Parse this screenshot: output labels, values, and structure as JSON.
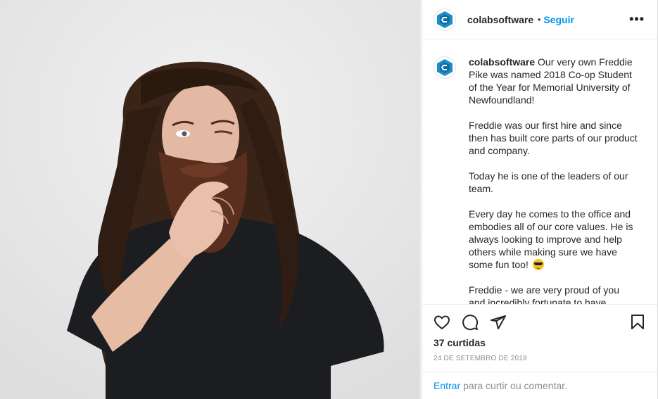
{
  "post": {
    "username": "colabsoftware",
    "follow_separator": "•",
    "follow_label": "Seguir",
    "more_label": "•••",
    "caption": {
      "username": "colabsoftware",
      "first_line": "Our very own Freddie Pike was named 2018 Co-op Student of the Year for Memorial University of Newfoundland!",
      "paragraph_2": "Freddie was our first hire and since then has built core parts of our product and company.",
      "paragraph_3": "Today he is one of the leaders of our team.",
      "paragraph_4": "Every day he comes to the office and embodies all of our core values. He is always looking to improve and help others while making sure we have some fun too!",
      "paragraph_5": "Freddie - we are very proud of you and incredibly fortunate to have"
    },
    "likes_label": "37 curtidas",
    "timestamp": "24 de setembro de 2019",
    "comment_bar": {
      "login_label": "Entrar",
      "rest_text": "para curtir ou comentar."
    }
  },
  "icons": {
    "like": "heart-icon",
    "comment": "comment-icon",
    "share": "share-icon",
    "save": "bookmark-icon",
    "emoji": "smiling-face-with-sunglasses-icon"
  },
  "colors": {
    "accent": "#0095f6",
    "text": "#262626",
    "muted": "#8e8e8e",
    "logo": "#1a8fc9"
  }
}
